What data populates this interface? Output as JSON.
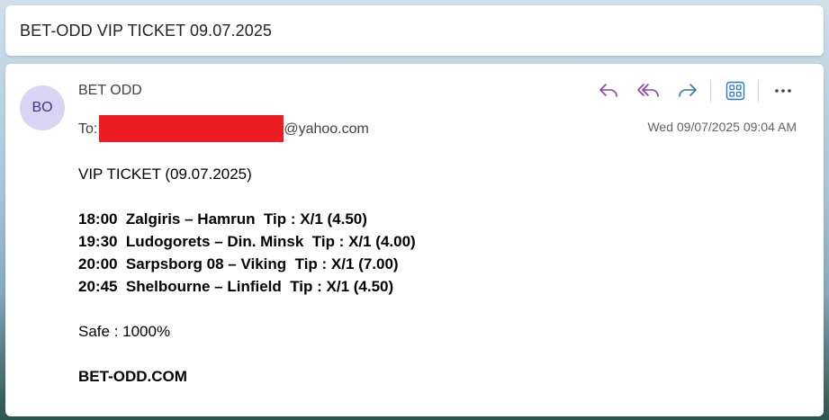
{
  "subject": "BET-ODD VIP TICKET 09.07.2025",
  "email": {
    "avatar_initials": "BO",
    "sender_name": "BET ODD",
    "to_label": "To:",
    "to_domain": "@yahoo.com",
    "date": "Wed 09/07/2025 09:04 AM",
    "actions": [
      "reply-icon",
      "reply-all-icon",
      "forward-icon",
      "apps-icon",
      "more-icon"
    ],
    "colors": {
      "reply_accent": "#8a3fb5",
      "forward_accent": "#2b78c4",
      "redaction": "#ee1d23",
      "avatar_bg": "#d9d3f4"
    }
  },
  "body": {
    "heading": "VIP TICKET (09.07.2025)",
    "matches": [
      "18:00  Zalgiris – Hamrun  Tip : X/1 (4.50)",
      "19:30  Ludogorets – Din. Minsk  Tip : X/1 (4.00)",
      "20:00  Sarpsborg 08 – Viking  Tip : X/1 (7.00)",
      "20:45  Shelbourne – Linfield  Tip : X/1 (4.50)"
    ],
    "safe": "Safe : 1000%",
    "site": "BET-ODD.COM"
  }
}
